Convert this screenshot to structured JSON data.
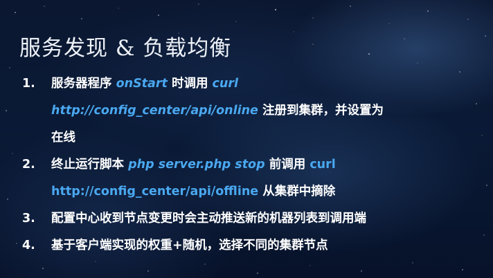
{
  "slide": {
    "title": "服务发现 & 负载均衡",
    "items": [
      {
        "number": "1.",
        "text_a": "服务器程序 ",
        "code_a": "onStart",
        "text_b": " 时调用 ",
        "code_b": "curl",
        "url": "http://config_center/api/online",
        "text_c": " 注册到集群，并设置为",
        "text_d": "在线"
      },
      {
        "number": "2.",
        "text_a": "终止运行脚本 ",
        "code_a": "php server.php stop",
        "text_b": " 前调用 ",
        "code_b": "curl",
        "url": "http://config_center/api/offline",
        "text_c": " 从集群中摘除"
      },
      {
        "number": "3.",
        "text": "配置中心收到节点变更时会主动推送新的机器列表到调用端"
      },
      {
        "number": "4.",
        "text": "基于客户端实现的权重+随机，选择不同的集群节点"
      }
    ]
  },
  "colors": {
    "background": "#0a1a36",
    "text": "#ffffff",
    "highlight": "#4aa8f0"
  }
}
